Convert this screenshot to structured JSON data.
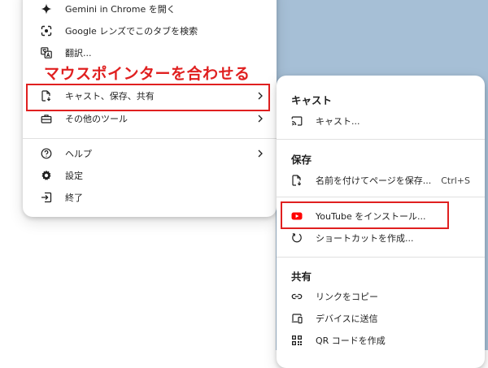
{
  "annotation": {
    "callout": "マウスポインターを合わせる"
  },
  "main_menu": {
    "items": [
      {
        "label": "Gemini in Chrome を開く",
        "icon": "sparkle-icon"
      },
      {
        "label": "Google レンズでこのタブを検索",
        "icon": "lens-icon"
      },
      {
        "label": "翻訳...",
        "icon": "translate-icon"
      },
      {
        "label": "キャスト、保存、共有",
        "icon": "save-file-icon",
        "has_submenu": true
      },
      {
        "label": "その他のツール",
        "icon": "toolbox-icon",
        "has_submenu": true
      },
      {
        "label": "ヘルプ",
        "icon": "help-icon",
        "has_submenu": true
      },
      {
        "label": "設定",
        "icon": "gear-icon"
      },
      {
        "label": "終了",
        "icon": "exit-icon"
      }
    ]
  },
  "sub_menu": {
    "cast_section": {
      "title": "キャスト",
      "items": [
        {
          "label": "キャスト...",
          "icon": "cast-icon"
        }
      ]
    },
    "save_section": {
      "title": "保存",
      "items": [
        {
          "label": "名前を付けてページを保存...",
          "icon": "save-page-icon",
          "shortcut": "Ctrl+S"
        },
        {
          "label": "YouTube をインストール...",
          "icon": "youtube-icon"
        },
        {
          "label": "ショートカットを作成...",
          "icon": "shortcut-icon"
        }
      ]
    },
    "share_section": {
      "title": "共有",
      "items": [
        {
          "label": "リンクをコピー",
          "icon": "link-icon"
        },
        {
          "label": "デバイスに送信",
          "icon": "devices-icon"
        },
        {
          "label": "QR コードを作成",
          "icon": "qr-code-icon"
        }
      ]
    }
  },
  "colors": {
    "highlight": "#e02020",
    "background_right": "#a6bfd6",
    "youtube_red": "#ff0000"
  }
}
